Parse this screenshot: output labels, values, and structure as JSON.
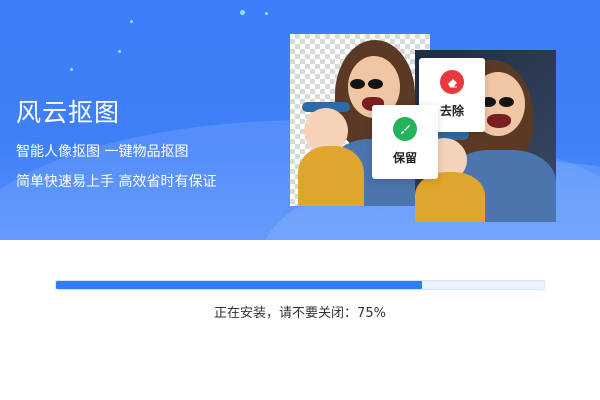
{
  "app": {
    "title": "风云抠图",
    "tagline_1": "智能人像抠图 一键物品抠图",
    "tagline_2": "简单快速易上手 高效省时有保证"
  },
  "actions": {
    "remove_label": "去除",
    "keep_label": "保留"
  },
  "install": {
    "status_text": "正在安装，请不要关闭：75%",
    "progress": 0.75
  },
  "colors": {
    "banner_blue": "#3f80f8",
    "progress_fill": "#2f7cf6",
    "remove_red": "#e8393f",
    "keep_green": "#22b35b"
  },
  "icons": {
    "remove": "eraser-icon",
    "keep": "brush-icon"
  }
}
